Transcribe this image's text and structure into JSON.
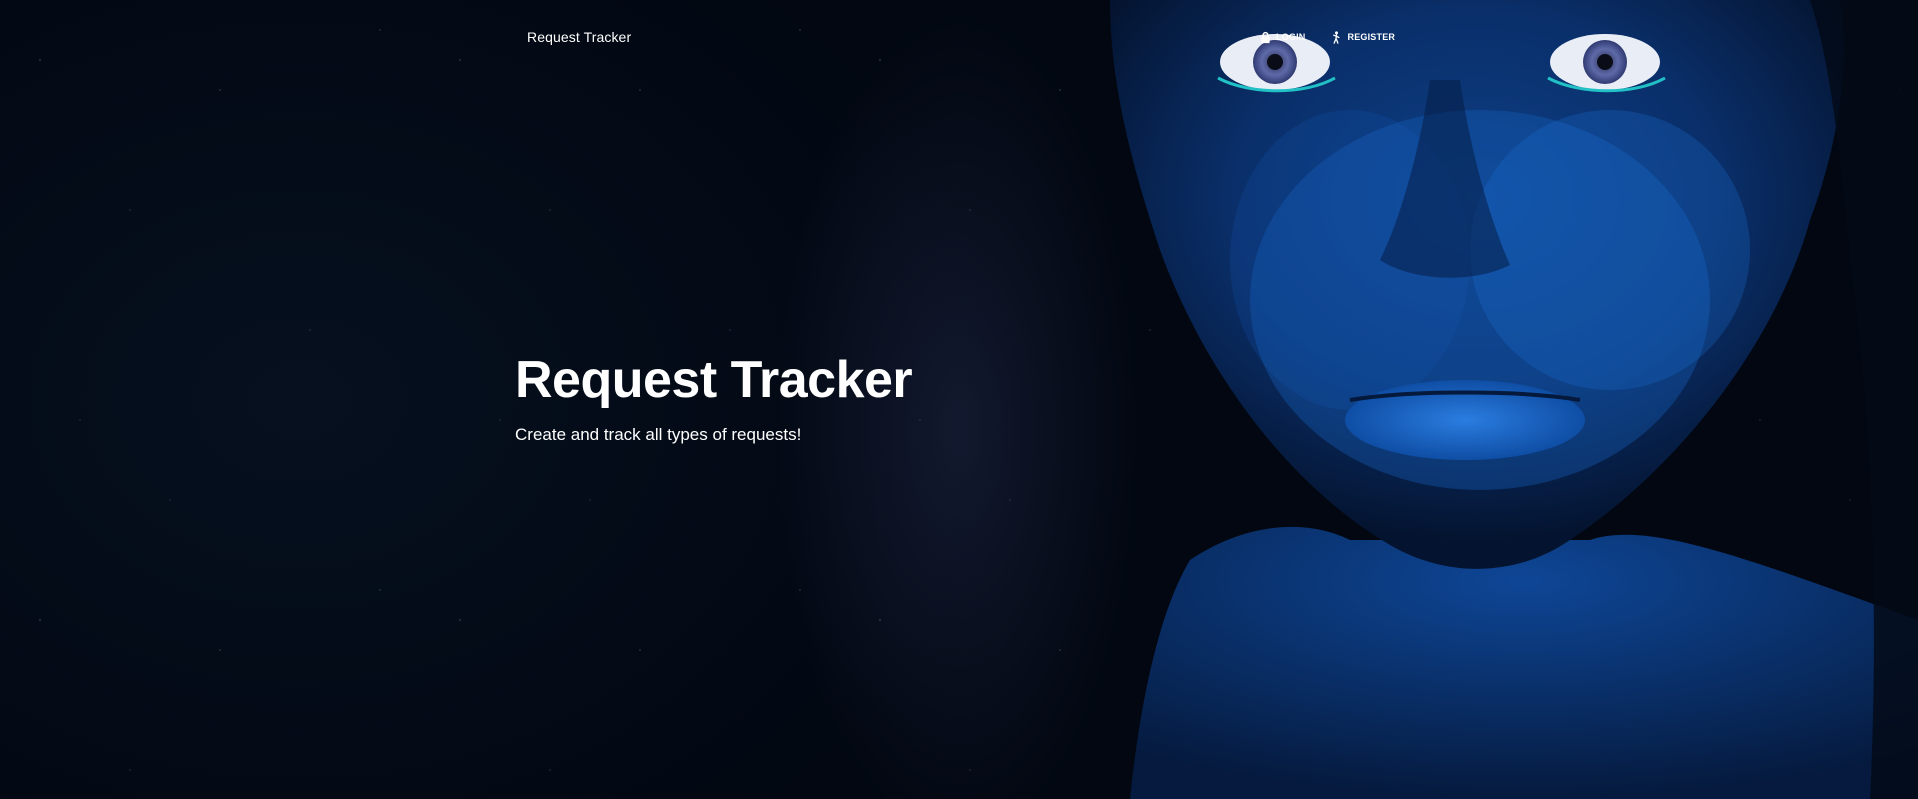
{
  "navbar": {
    "brand": "Request Tracker",
    "links": [
      {
        "label": "LOGIN",
        "icon": "lock-icon"
      },
      {
        "label": "REGISTER",
        "icon": "person-walking-icon"
      }
    ]
  },
  "hero": {
    "title": "Request Tracker",
    "subtitle": "Create and track all types of requests!",
    "background_image": "blue-painted-face-on-starry-night"
  },
  "colors": {
    "background": "#020812",
    "text": "#ffffff",
    "face_blue": "#1663c4"
  }
}
